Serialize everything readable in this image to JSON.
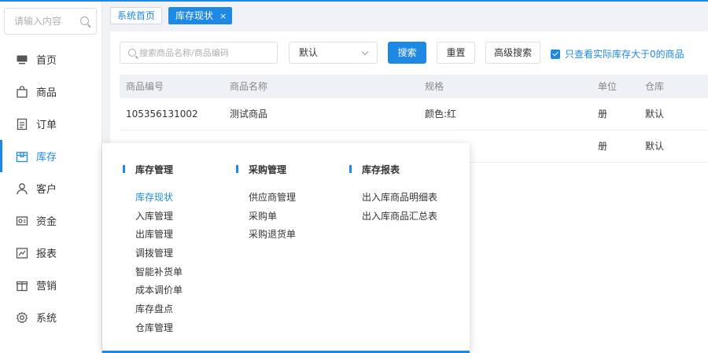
{
  "sidebar": {
    "search_placeholder": "请输入内容",
    "items": [
      {
        "label": "首页",
        "icon": "monitor-icon"
      },
      {
        "label": "商品",
        "icon": "bag-icon"
      },
      {
        "label": "订单",
        "icon": "document-icon"
      },
      {
        "label": "库存",
        "icon": "box-icon",
        "active": true
      },
      {
        "label": "客户",
        "icon": "user-icon"
      },
      {
        "label": "资金",
        "icon": "wallet-icon"
      },
      {
        "label": "报表",
        "icon": "chart-icon"
      },
      {
        "label": "营销",
        "icon": "gift-icon"
      },
      {
        "label": "系统",
        "icon": "gear-icon"
      }
    ]
  },
  "tabs": [
    {
      "label": "系统首页"
    },
    {
      "label": "库存现状",
      "active": true,
      "close": "×"
    }
  ],
  "toolbar": {
    "search_placeholder": "搜索商品名称/商品编码",
    "select_value": "默认",
    "search_btn": "搜索",
    "reset_btn": "重置",
    "advanced_btn": "高级搜索",
    "checkbox_label": "只查看实际库存大于0的商品"
  },
  "table": {
    "headers": [
      "商品编号",
      "商品名称",
      "规格",
      "单位",
      "仓库"
    ],
    "rows": [
      [
        "105356131002",
        "测试商品",
        "颜色:红",
        "册",
        "默认"
      ],
      [
        "",
        "",
        "",
        "册",
        "默认"
      ]
    ]
  },
  "flyout": {
    "columns": [
      {
        "title": "库存管理",
        "items": [
          "库存现状",
          "入库管理",
          "出库管理",
          "调拨管理",
          "智能补货单",
          "成本调价单",
          "库存盘点",
          "仓库管理"
        ]
      },
      {
        "title": "采购管理",
        "items": [
          "供应商管理",
          "采购单",
          "采购退货单"
        ]
      },
      {
        "title": "库存报表",
        "items": [
          "出入库商品明细表",
          "出入库商品汇总表"
        ]
      }
    ]
  },
  "colors": {
    "accent": "#1e88e5"
  }
}
